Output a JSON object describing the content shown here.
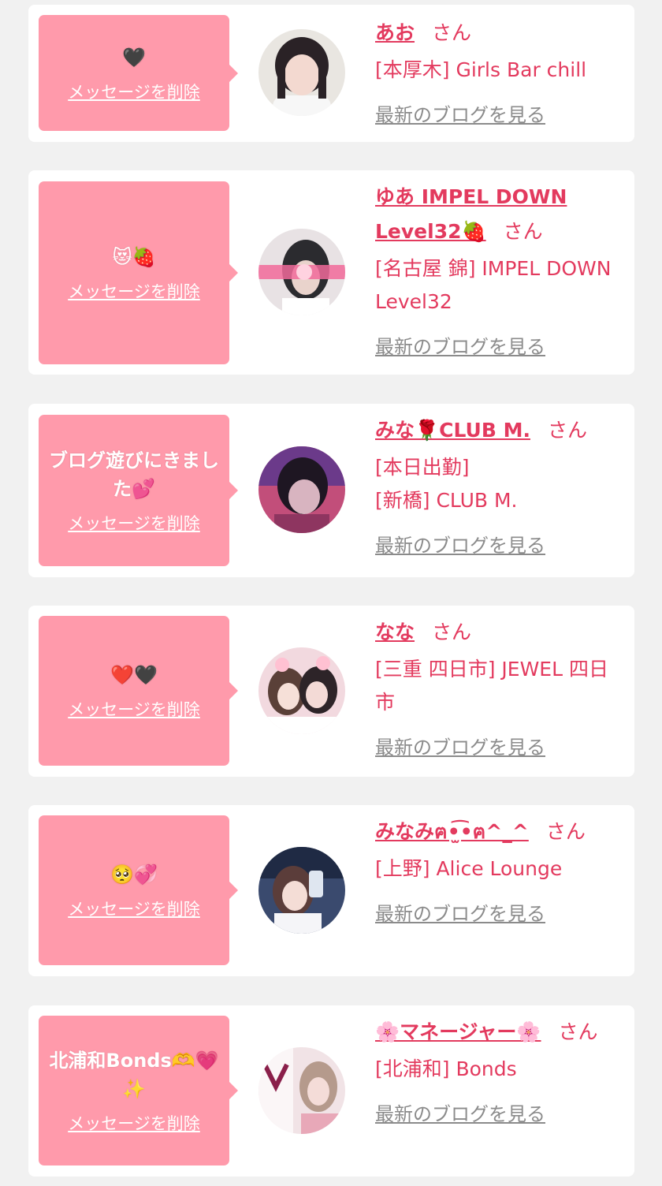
{
  "common": {
    "delete_label": "メッセージを削除",
    "blog_label": "最新のブログを見る",
    "san": "さん"
  },
  "items": [
    {
      "message": "🖤",
      "name": "あお",
      "shop_lines": [
        "[本厚木] Girls Bar chill"
      ]
    },
    {
      "message": "😻🍓",
      "name": "ゆあ IMPEL DOWN Level32🍓",
      "shop_lines": [
        "[名古屋 錦] IMPEL DOWN Level32"
      ]
    },
    {
      "message": "ブログ遊びにきました💕",
      "name": "みな🌹CLUB M.",
      "shop_lines": [
        "[本日出勤]",
        "[新橋] CLUB M."
      ]
    },
    {
      "message": "❤️🖤",
      "name": "なな",
      "shop_lines": [
        "[三重 四日市] JEWEL 四日市"
      ]
    },
    {
      "message": "🥺💞",
      "name": "みなみฅ•̫͡•ฅ^_^",
      "shop_lines": [
        "[上野] Alice Lounge"
      ]
    },
    {
      "message": "北浦和Bonds🫶💗✨",
      "name": "🌸マネージャー🌸",
      "shop_lines": [
        "[北浦和] Bonds"
      ]
    }
  ]
}
